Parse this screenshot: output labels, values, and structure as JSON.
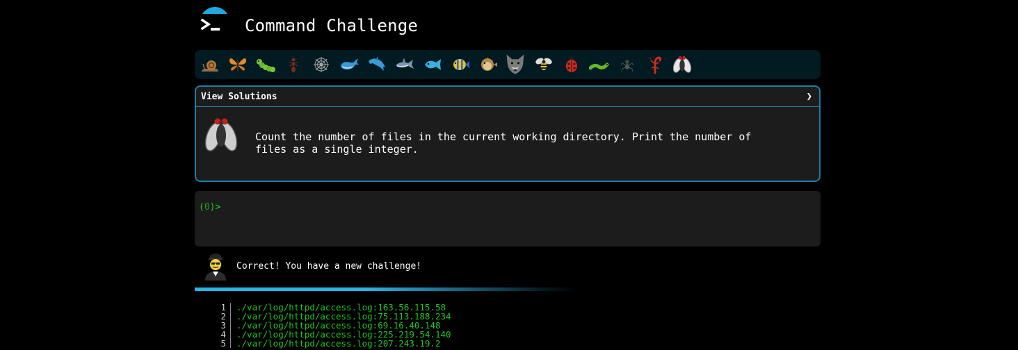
{
  "header": {
    "title": "Command Challenge"
  },
  "creatures": [
    {
      "name": "snail-icon"
    },
    {
      "name": "butterfly-icon"
    },
    {
      "name": "caterpillar-icon"
    },
    {
      "name": "ant-icon"
    },
    {
      "name": "spiderweb-icon"
    },
    {
      "name": "whale-icon"
    },
    {
      "name": "dolphin-icon"
    },
    {
      "name": "shark-icon"
    },
    {
      "name": "fish-icon"
    },
    {
      "name": "tropical-fish-icon"
    },
    {
      "name": "blowfish-icon"
    },
    {
      "name": "wolf-icon"
    },
    {
      "name": "bee-icon"
    },
    {
      "name": "ladybug-icon"
    },
    {
      "name": "worm-icon"
    },
    {
      "name": "spider-icon"
    },
    {
      "name": "scorpion-icon"
    },
    {
      "name": "fly-icon"
    }
  ],
  "panel": {
    "title": "View Solutions",
    "chevron": "❯",
    "challenge": "Count the number of files in the current working directory. Print the number of files as a single integer."
  },
  "terminal": {
    "prompt_open": "(",
    "prompt_num": "0",
    "prompt_close": ")",
    "prompt_caret": ">"
  },
  "message": "Correct! You have a new challenge!",
  "colors": {
    "accent": "#2bb5e6",
    "prompt_green": "#1ec81e",
    "panel_bg": "#1c1c1c",
    "border": "#1f7fa8"
  },
  "output": {
    "lines": [
      {
        "n": "1",
        "text": "./var/log/httpd/access.log:163.56.115.58"
      },
      {
        "n": "2",
        "text": "./var/log/httpd/access.log:75.113.188.234"
      },
      {
        "n": "3",
        "text": "./var/log/httpd/access.log:69.16.40.148"
      },
      {
        "n": "4",
        "text": "./var/log/httpd/access.log:225.219.54.140"
      },
      {
        "n": "5",
        "text": "./var/log/httpd/access.log:207.243.19.2"
      }
    ]
  }
}
